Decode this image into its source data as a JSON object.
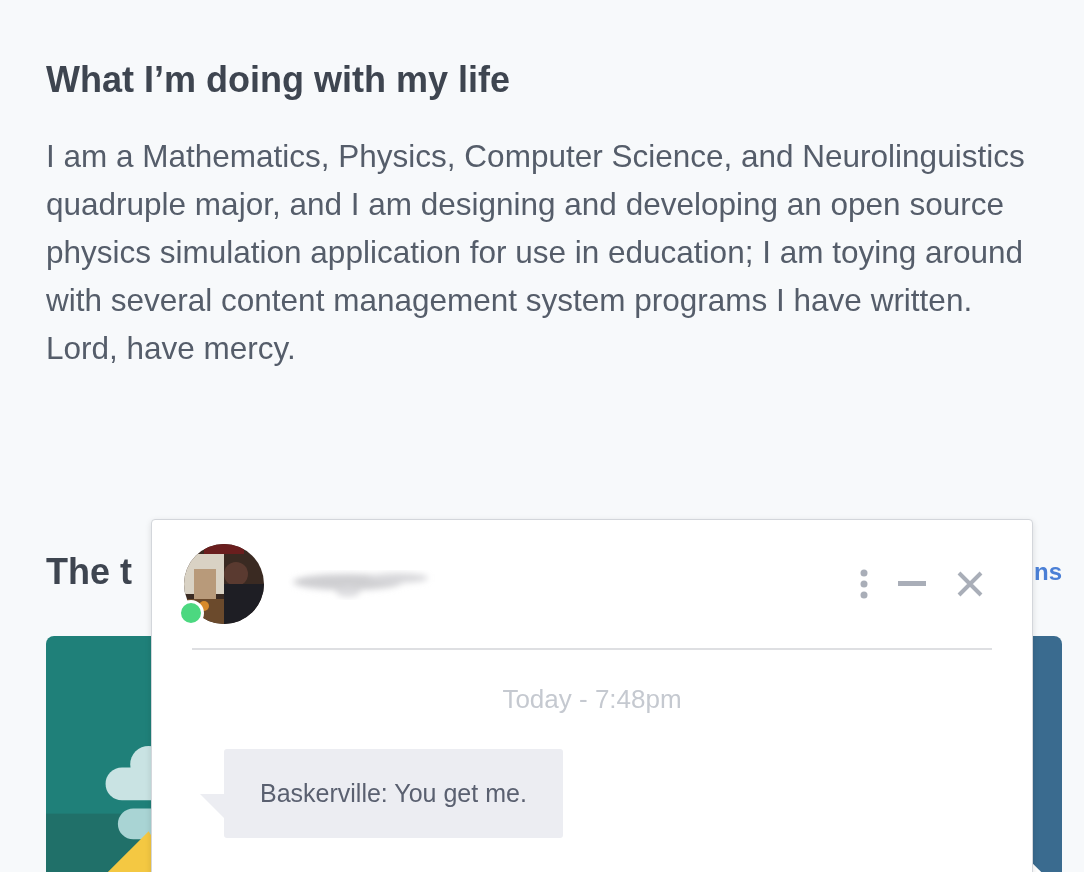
{
  "about": {
    "heading": "What I’m doing with my life",
    "paragraph": "I am a Mathematics, Physics, Computer Science, and Neurolinguistics quadruple major, and I am designing and developing an open source physics simulation application for use in education; I am toying around with several content management system programs I have written. Lord, have mercy."
  },
  "section": {
    "heading": "The t",
    "link": "ns"
  },
  "chat": {
    "online": true,
    "timestamp": "Today - 7:48pm",
    "messages": [
      {
        "text": "Baskerville: You get me."
      }
    ]
  }
}
